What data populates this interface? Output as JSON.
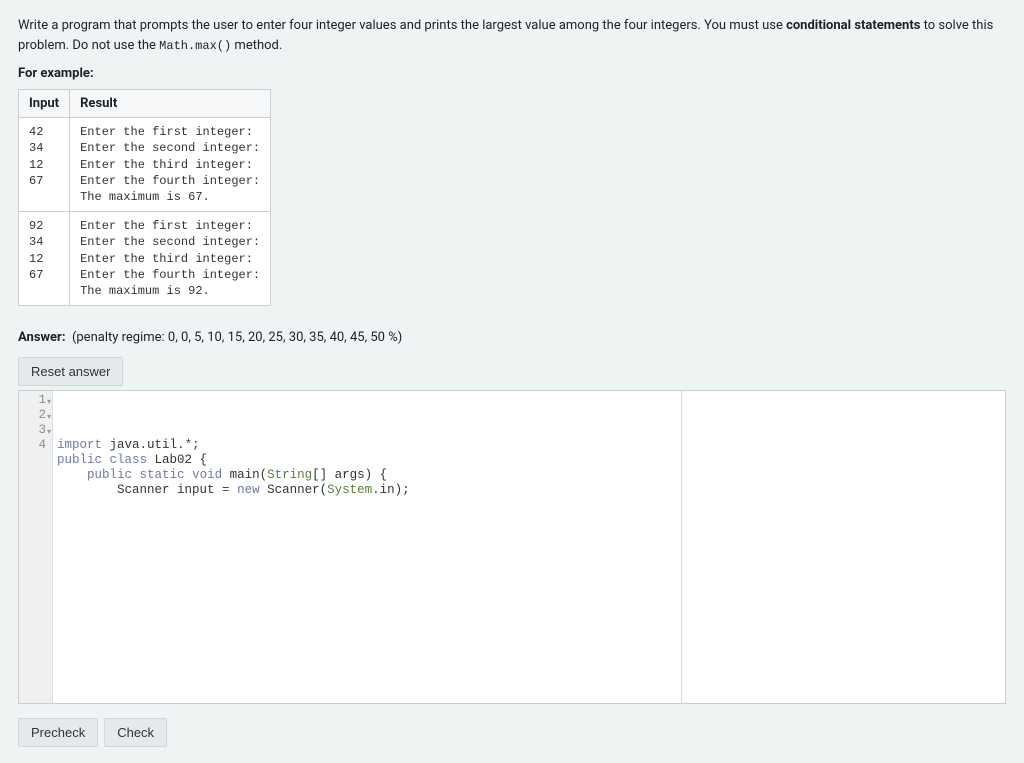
{
  "prompt": {
    "part1": "Write a program that prompts the user to enter four integer values and prints the largest value among the four integers. You must use ",
    "strong1": "conditional statements",
    "part2": " to solve this problem. Do not use the ",
    "code": "Math.max()",
    "part3": " method."
  },
  "example_label": "For example:",
  "table": {
    "headers": [
      "Input",
      "Result"
    ],
    "rows": [
      {
        "input": "42\n34\n12\n67",
        "result": "Enter the first integer:\nEnter the second integer:\nEnter the third integer:\nEnter the fourth integer:\nThe maximum is 67."
      },
      {
        "input": "92\n34\n12\n67",
        "result": "Enter the first integer:\nEnter the second integer:\nEnter the third integer:\nEnter the fourth integer:\nThe maximum is 92."
      }
    ]
  },
  "answer": {
    "label": "Answer:",
    "penalty": "(penalty regime: 0, 0, 5, 10, 15, 20, 25, 30, 35, 40, 45, 50 %)"
  },
  "buttons": {
    "reset": "Reset answer",
    "precheck": "Precheck",
    "check": "Check"
  },
  "editor": {
    "line_numbers": [
      "1",
      "2",
      "3",
      "4"
    ],
    "code_tokens": [
      [
        {
          "t": "import",
          "c": "tok-kw"
        },
        {
          "t": " java",
          "c": "tok-id"
        },
        {
          "t": ".",
          "c": "tok-op"
        },
        {
          "t": "util",
          "c": "tok-id"
        },
        {
          "t": ".",
          "c": "tok-op"
        },
        {
          "t": "*",
          "c": "tok-op"
        },
        {
          "t": ";",
          "c": "tok-op"
        }
      ],
      [
        {
          "t": "public",
          "c": "tok-kw"
        },
        {
          "t": " ",
          "c": ""
        },
        {
          "t": "class",
          "c": "tok-kw"
        },
        {
          "t": " Lab02 {",
          "c": "tok-id"
        }
      ],
      [
        {
          "t": "    ",
          "c": ""
        },
        {
          "t": "public",
          "c": "tok-kw"
        },
        {
          "t": " ",
          "c": ""
        },
        {
          "t": "static",
          "c": "tok-kw"
        },
        {
          "t": " ",
          "c": ""
        },
        {
          "t": "void",
          "c": "tok-kw"
        },
        {
          "t": " main(",
          "c": "tok-id"
        },
        {
          "t": "String",
          "c": "tok-type"
        },
        {
          "t": "[] args) {",
          "c": "tok-id"
        }
      ],
      [
        {
          "t": "        Scanner input ",
          "c": "tok-id"
        },
        {
          "t": "=",
          "c": "tok-op"
        },
        {
          "t": " ",
          "c": ""
        },
        {
          "t": "new",
          "c": "tok-kw"
        },
        {
          "t": " Scanner(",
          "c": "tok-id"
        },
        {
          "t": "System",
          "c": "tok-type"
        },
        {
          "t": ".",
          "c": "tok-op"
        },
        {
          "t": "in);",
          "c": "tok-id"
        }
      ]
    ]
  }
}
